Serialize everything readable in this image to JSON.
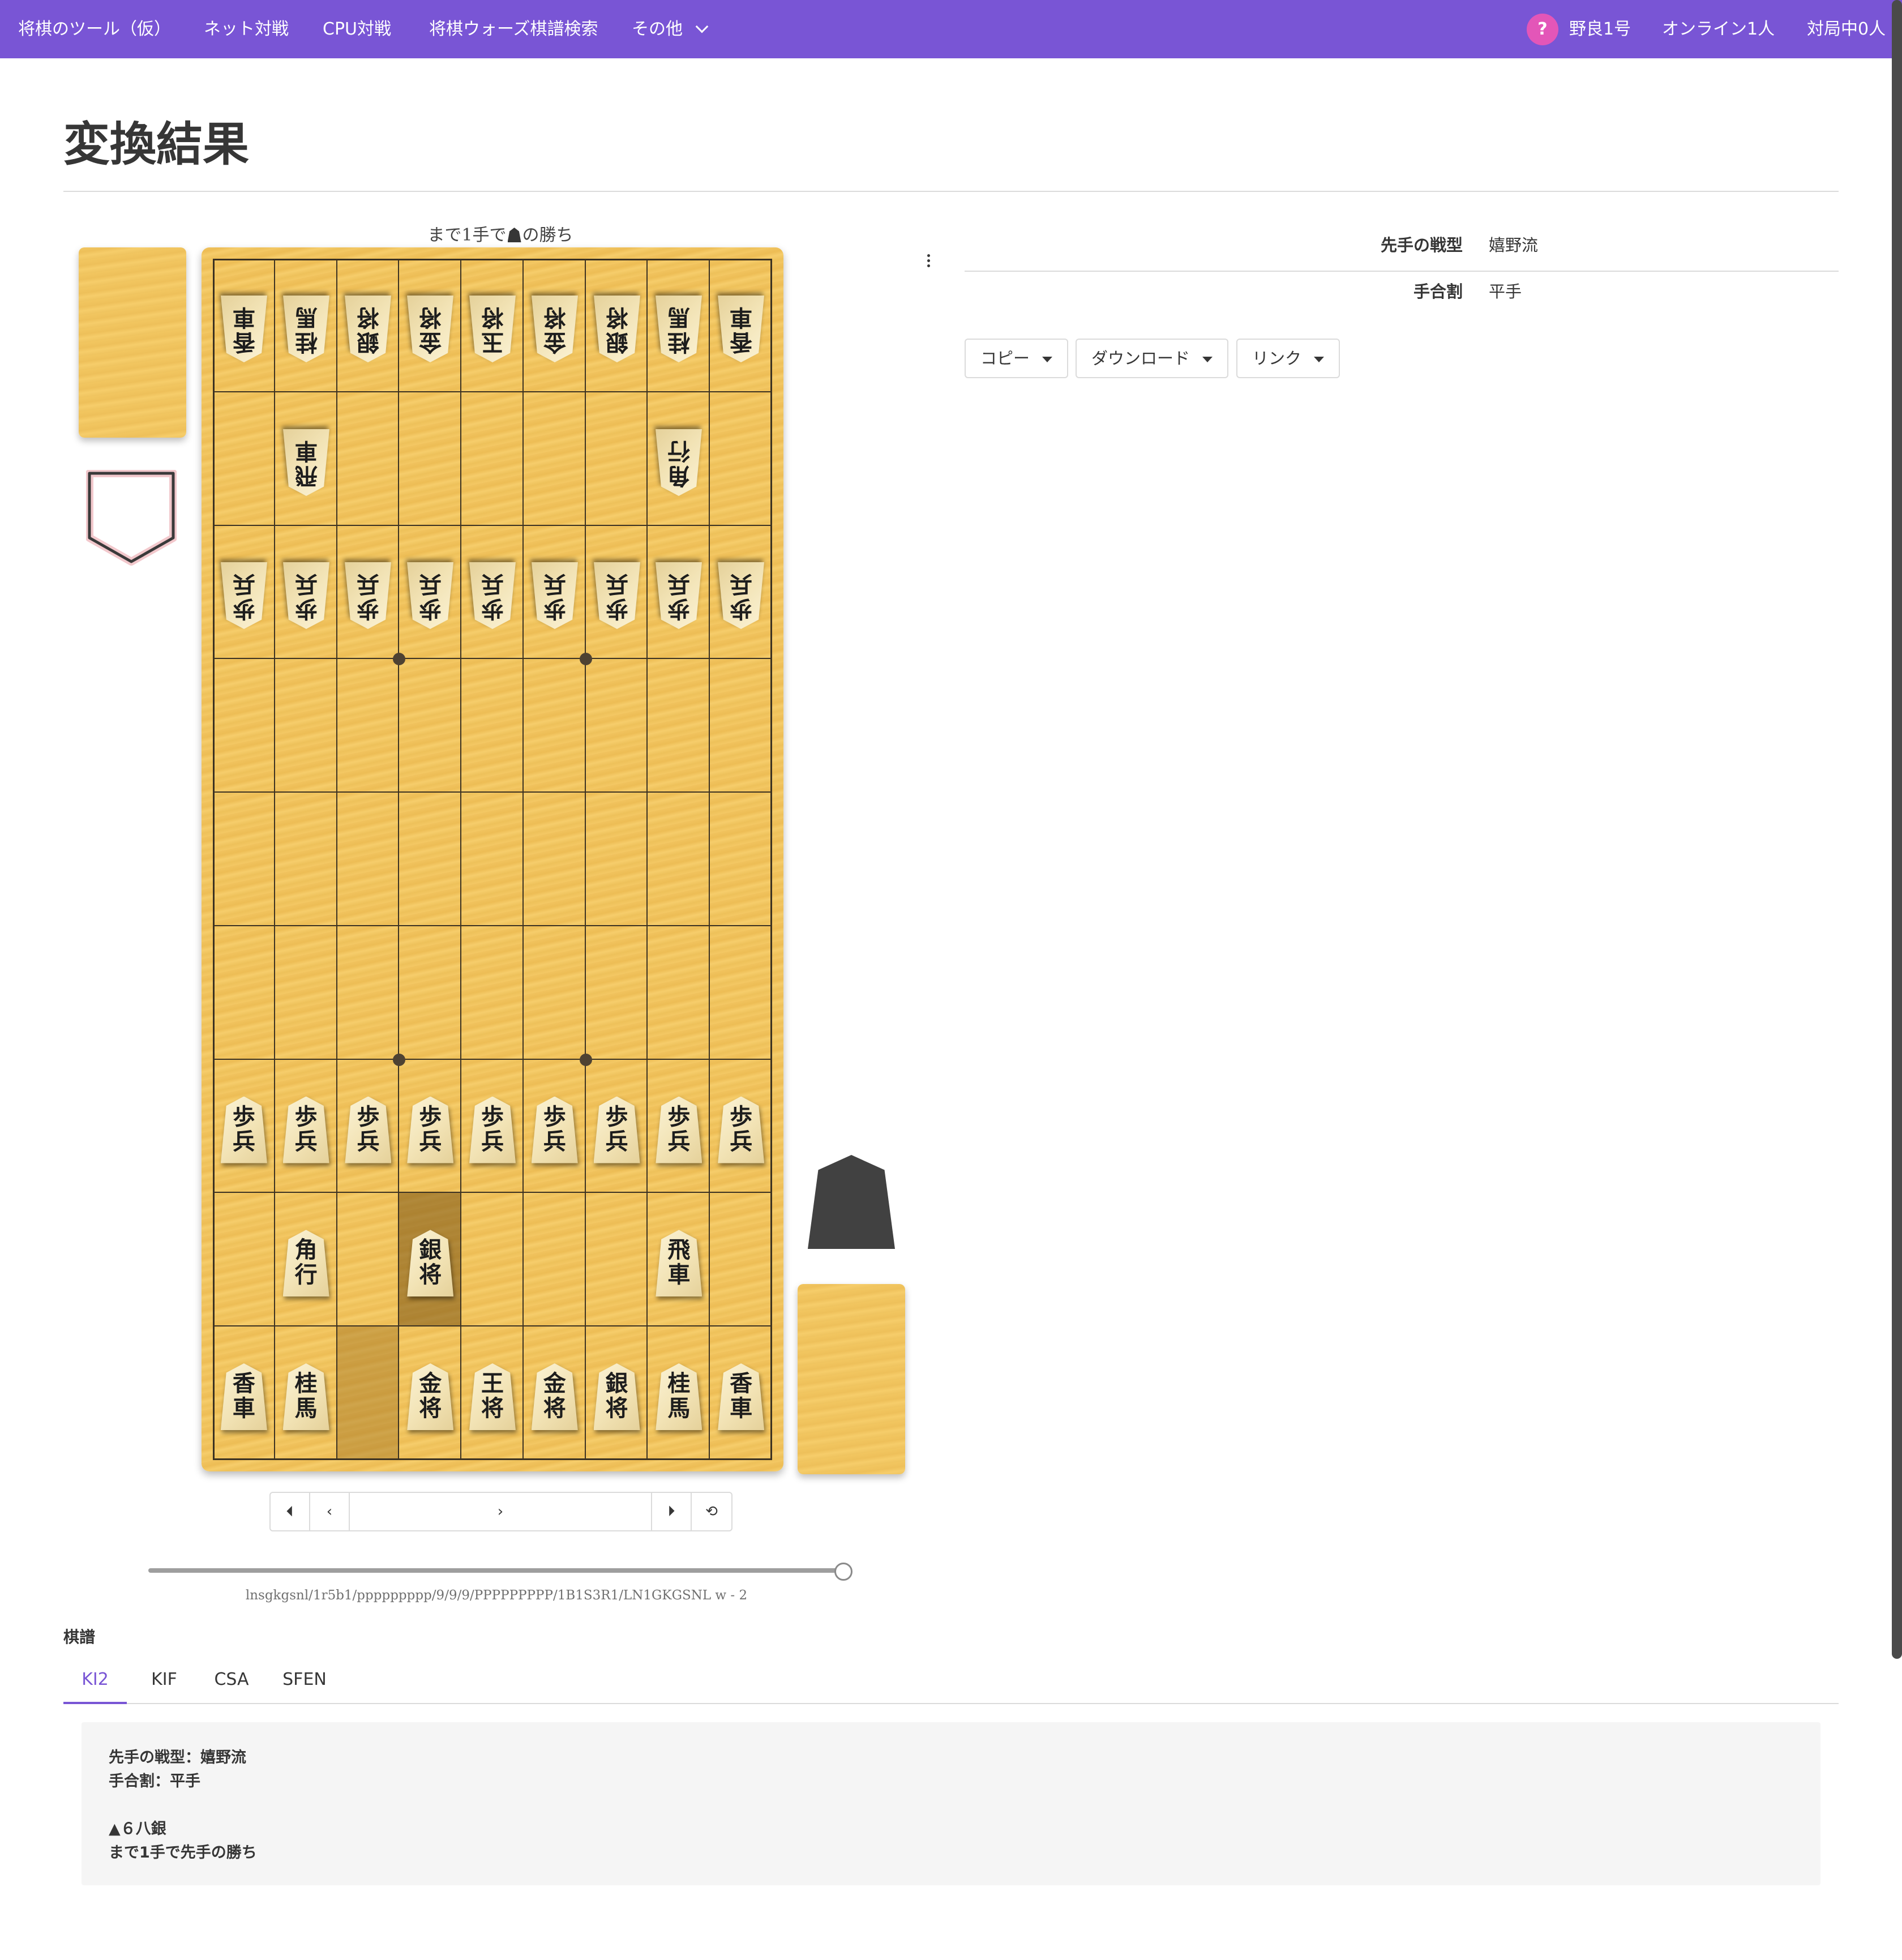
{
  "nav": {
    "brand": "将棋のツール（仮）",
    "links": [
      "ネット対戦",
      "CPU対戦",
      "将棋ウォーズ棋譜検索",
      "その他"
    ],
    "avatar_glyph": "?",
    "user_name": "野良1号",
    "online": "オンライン1人",
    "playing": "対局中0人"
  },
  "page_title": "変換結果",
  "board": {
    "result_pre": "まで1手で",
    "result_post": "の勝ち",
    "pieces": [
      {
        "col": 9,
        "row": 1,
        "glyph": "香\n車",
        "side": "gote"
      },
      {
        "col": 8,
        "row": 1,
        "glyph": "桂\n馬",
        "side": "gote"
      },
      {
        "col": 7,
        "row": 1,
        "glyph": "銀\n将",
        "side": "gote"
      },
      {
        "col": 6,
        "row": 1,
        "glyph": "金\n将",
        "side": "gote"
      },
      {
        "col": 5,
        "row": 1,
        "glyph": "玉\n将",
        "side": "gote"
      },
      {
        "col": 4,
        "row": 1,
        "glyph": "金\n将",
        "side": "gote"
      },
      {
        "col": 3,
        "row": 1,
        "glyph": "銀\n将",
        "side": "gote"
      },
      {
        "col": 2,
        "row": 1,
        "glyph": "桂\n馬",
        "side": "gote"
      },
      {
        "col": 1,
        "row": 1,
        "glyph": "香\n車",
        "side": "gote"
      },
      {
        "col": 8,
        "row": 2,
        "glyph": "飛\n車",
        "side": "gote"
      },
      {
        "col": 2,
        "row": 2,
        "glyph": "角\n行",
        "side": "gote"
      },
      {
        "col": 9,
        "row": 3,
        "glyph": "歩\n兵",
        "side": "gote"
      },
      {
        "col": 8,
        "row": 3,
        "glyph": "歩\n兵",
        "side": "gote"
      },
      {
        "col": 7,
        "row": 3,
        "glyph": "歩\n兵",
        "side": "gote"
      },
      {
        "col": 6,
        "row": 3,
        "glyph": "歩\n兵",
        "side": "gote"
      },
      {
        "col": 5,
        "row": 3,
        "glyph": "歩\n兵",
        "side": "gote"
      },
      {
        "col": 4,
        "row": 3,
        "glyph": "歩\n兵",
        "side": "gote"
      },
      {
        "col": 3,
        "row": 3,
        "glyph": "歩\n兵",
        "side": "gote"
      },
      {
        "col": 2,
        "row": 3,
        "glyph": "歩\n兵",
        "side": "gote"
      },
      {
        "col": 1,
        "row": 3,
        "glyph": "歩\n兵",
        "side": "gote"
      },
      {
        "col": 9,
        "row": 7,
        "glyph": "歩\n兵",
        "side": "sente"
      },
      {
        "col": 8,
        "row": 7,
        "glyph": "歩\n兵",
        "side": "sente"
      },
      {
        "col": 7,
        "row": 7,
        "glyph": "歩\n兵",
        "side": "sente"
      },
      {
        "col": 6,
        "row": 7,
        "glyph": "歩\n兵",
        "side": "sente"
      },
      {
        "col": 5,
        "row": 7,
        "glyph": "歩\n兵",
        "side": "sente"
      },
      {
        "col": 4,
        "row": 7,
        "glyph": "歩\n兵",
        "side": "sente"
      },
      {
        "col": 3,
        "row": 7,
        "glyph": "歩\n兵",
        "side": "sente"
      },
      {
        "col": 2,
        "row": 7,
        "glyph": "歩\n兵",
        "side": "sente"
      },
      {
        "col": 1,
        "row": 7,
        "glyph": "歩\n兵",
        "side": "sente"
      },
      {
        "col": 8,
        "row": 8,
        "glyph": "角\n行",
        "side": "sente"
      },
      {
        "col": 6,
        "row": 8,
        "glyph": "銀\n将",
        "side": "sente"
      },
      {
        "col": 2,
        "row": 8,
        "glyph": "飛\n車",
        "side": "sente"
      },
      {
        "col": 9,
        "row": 9,
        "glyph": "香\n車",
        "side": "sente"
      },
      {
        "col": 8,
        "row": 9,
        "glyph": "桂\n馬",
        "side": "sente"
      },
      {
        "col": 6,
        "row": 9,
        "glyph": "金\n将",
        "side": "sente"
      },
      {
        "col": 5,
        "row": 9,
        "glyph": "王\n将",
        "side": "sente"
      },
      {
        "col": 4,
        "row": 9,
        "glyph": "金\n将",
        "side": "sente"
      },
      {
        "col": 3,
        "row": 9,
        "glyph": "銀\n将",
        "side": "sente"
      },
      {
        "col": 2,
        "row": 9,
        "glyph": "桂\n馬",
        "side": "sente"
      },
      {
        "col": 1,
        "row": 9,
        "glyph": "香\n車",
        "side": "sente"
      }
    ],
    "last_move_to": {
      "col": 6,
      "row": 8
    },
    "last_move_from": {
      "col": 7,
      "row": 9
    }
  },
  "controls": {
    "first": "⏴",
    "prev": "‹",
    "next": "›",
    "last": "⏵",
    "flip": "⟲",
    "slider_position": 1.0
  },
  "sfen": "lnsgkgsnl/1r5b1/ppppppppp/9/9/9/PPPPPPPPP/1B1S3R1/LN1GKGSNL w - 2",
  "info": {
    "rows": [
      {
        "key": "先手の戦型",
        "value": "嬉野流"
      },
      {
        "key": "手合割",
        "value": "平手"
      }
    ],
    "buttons": [
      "コピー",
      "ダウンロード",
      "リンク"
    ]
  },
  "kifu": {
    "heading": "棋譜",
    "tabs": [
      "KI2",
      "KIF",
      "CSA",
      "SFEN"
    ],
    "active_tab": "KI2",
    "lines": [
      "先手の戦型：嬉野流",
      "手合割：平手",
      "",
      "▲６八銀",
      "まで1手で先手の勝ち"
    ]
  }
}
